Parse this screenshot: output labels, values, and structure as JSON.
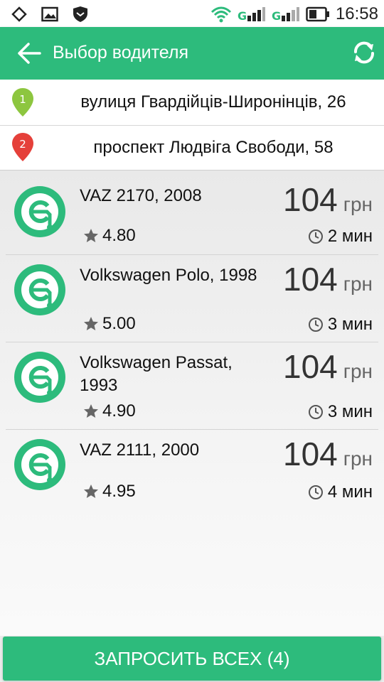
{
  "status_bar": {
    "time": "16:58",
    "icons": [
      "location-icon",
      "image-icon",
      "shield-icon",
      "wifi-icon",
      "signal-icon",
      "signal-icon",
      "battery-icon"
    ]
  },
  "app_bar": {
    "title": "Выбор водителя",
    "back_icon": "arrow-back-icon",
    "refresh_icon": "refresh-icon"
  },
  "route": {
    "from": {
      "marker": "1",
      "address": "вулиця Гвардійців-Широнінців, 26",
      "color": "#8dc63f"
    },
    "to": {
      "marker": "2",
      "address": "проспект Людвіга Свободи, 58",
      "color": "#e5403a"
    }
  },
  "drivers": [
    {
      "car": "VAZ 2170, 2008",
      "rating": "4.80",
      "price": "104",
      "currency": "грн",
      "eta": "2 мин"
    },
    {
      "car": "Volkswagen Polo, 1998",
      "rating": "5.00",
      "price": "104",
      "currency": "грн",
      "eta": "3 мин"
    },
    {
      "car": "Volkswagen Passat, 1993",
      "rating": "4.90",
      "price": "104",
      "currency": "грн",
      "eta": "3 мин"
    },
    {
      "car": "VAZ 2111, 2000",
      "rating": "4.95",
      "price": "104",
      "currency": "грн",
      "eta": "4 мин"
    }
  ],
  "action": {
    "label": "ЗАПРОСИТЬ ВСЕХ (4)"
  },
  "colors": {
    "accent": "#2dbb7c",
    "marker_from": "#8dc63f",
    "marker_to": "#e5403a"
  }
}
